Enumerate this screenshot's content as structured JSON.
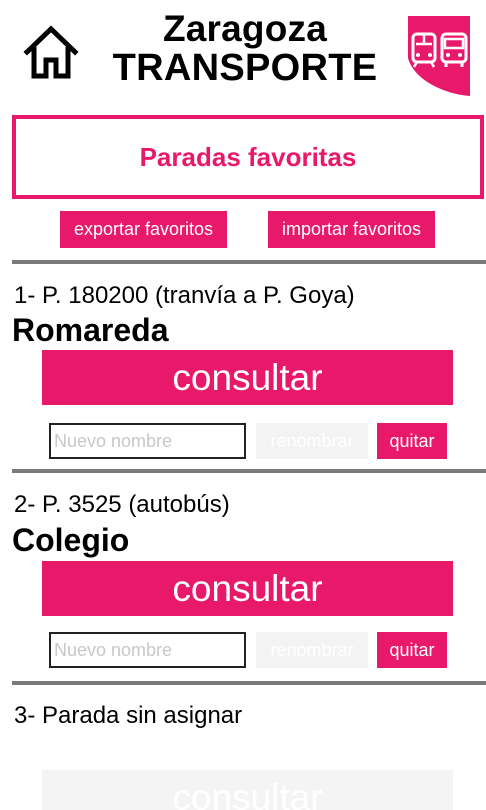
{
  "header": {
    "title_line1": "Zaragoza",
    "title_line2": "TRANSPORTE",
    "home_icon": "home-icon",
    "logo_icon": "tram-bus-logo-icon",
    "accent_color": "#e8196b"
  },
  "favorites": {
    "title": "Paradas favoritas",
    "export_label": "exportar favoritos",
    "import_label": "importar favoritos"
  },
  "stops": [
    {
      "meta": "1- P. 180200 (tranvía a P. Goya)",
      "name": "Romareda",
      "consult_label": "consultar",
      "rename_placeholder": "Nuevo nombre",
      "rename_label": "renombrar",
      "remove_label": "quitar"
    },
    {
      "meta": "2- P. 3525 (autobús)",
      "name": "Colegio",
      "consult_label": "consultar",
      "rename_placeholder": "Nuevo nombre",
      "rename_label": "renombrar",
      "remove_label": "quitar"
    },
    {
      "meta": "3- Parada sin asignar",
      "consult_label": "consultar"
    }
  ]
}
